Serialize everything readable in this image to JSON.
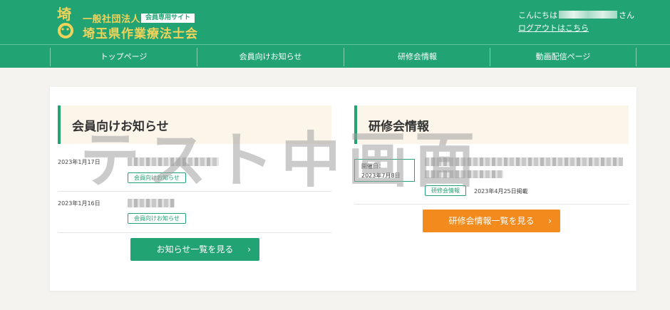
{
  "header": {
    "org_sub": "一般社団法人",
    "member_tag": "会員専用サイト",
    "org_name": "埼玉県作業療法士会",
    "greeting_prefix": "こんにちは",
    "greeting_suffix": "さん",
    "logout": "ログアウトはこちら",
    "brand_color": "#22a374",
    "logo_color": "#f2d35a"
  },
  "nav": {
    "items": [
      {
        "label": "トップページ"
      },
      {
        "label": "会員向けお知らせ"
      },
      {
        "label": "研修会情報"
      },
      {
        "label": "動画配信ページ"
      }
    ]
  },
  "news": {
    "title": "会員向けお知らせ",
    "items": [
      {
        "date": "2023年1月17日",
        "tag": "会員向けお知らせ"
      },
      {
        "date": "2023年1月16日",
        "tag": "会員向けお知らせ"
      }
    ],
    "more_button": "お知らせ一覧を見る",
    "arrow": "›"
  },
  "seminar": {
    "title": "研修会情報",
    "items": [
      {
        "held_label": "開催日：",
        "held_date": "2023年7月8日",
        "tag": "研修会情報",
        "posted": "2023年4月25日掲載"
      }
    ],
    "more_button": "研修会情報一覧を見る",
    "arrow": "›",
    "accent_color": "#f28a1e"
  },
  "watermark": "テスト中画面"
}
